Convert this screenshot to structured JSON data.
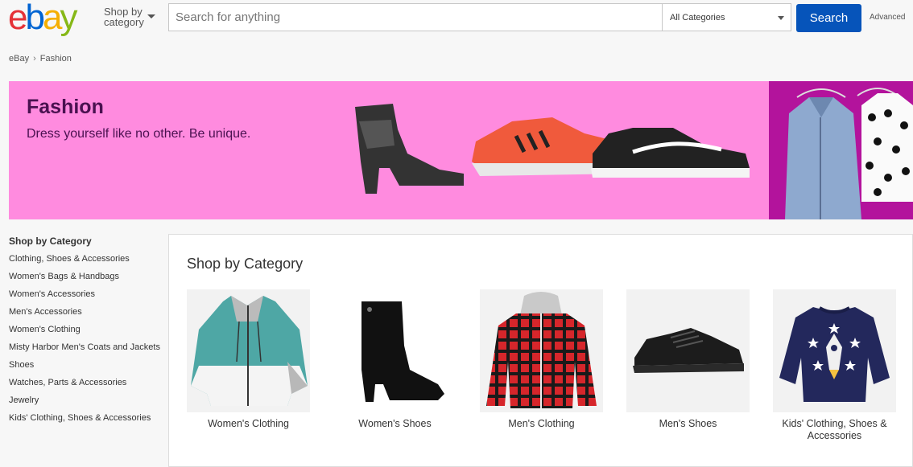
{
  "header": {
    "logo": {
      "letters": [
        "e",
        "b",
        "a",
        "y"
      ],
      "colors": [
        "#e53238",
        "#0064d2",
        "#f5af02",
        "#86b817"
      ]
    },
    "shop_by_line1": "Shop by",
    "shop_by_line2": "category",
    "search_placeholder": "Search for anything",
    "category_select": "All Categories",
    "search_button": "Search",
    "advanced_link": "Advanced"
  },
  "breadcrumb": {
    "home": "eBay",
    "current": "Fashion"
  },
  "hero": {
    "title": "Fashion",
    "subtitle": "Dress yourself like no other. Be unique.",
    "background_color": "#ff8bdf",
    "accent_color": "#b3139c"
  },
  "sidebar": {
    "title": "Shop by Category",
    "items": [
      "Clothing, Shoes & Accessories",
      "Women's Bags & Handbags",
      "Women's Accessories",
      "Men's Accessories",
      "Women's Clothing",
      "Misty Harbor Men's Coats and Jackets",
      "Shoes",
      "Watches, Parts & Accessories",
      "Jewelry",
      "Kids' Clothing, Shoes & Accessories"
    ]
  },
  "main": {
    "title": "Shop by Category",
    "categories": [
      {
        "label": "Women's Clothing",
        "icon": "jacket-image"
      },
      {
        "label": "Women's Shoes",
        "icon": "boot-image"
      },
      {
        "label": "Men's Clothing",
        "icon": "plaid-shirt-image"
      },
      {
        "label": "Men's Shoes",
        "icon": "sneaker-image"
      },
      {
        "label": "Kids' Clothing, Shoes & Accessories",
        "icon": "kids-sweater-image"
      }
    ]
  },
  "colors": {
    "search_button": "#0654ba",
    "page_background": "#f7f7f7"
  }
}
